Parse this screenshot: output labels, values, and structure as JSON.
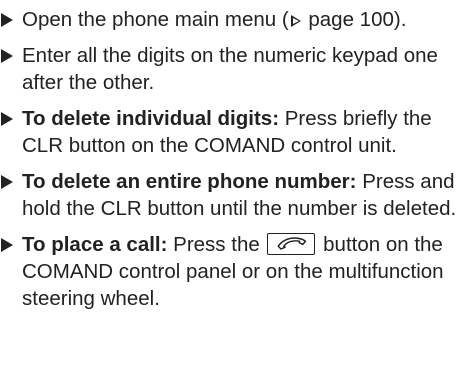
{
  "steps": [
    {
      "text_before": "Open the phone main menu (",
      "ref_icon": "triangle-outline-icon",
      "text_after": " page 100)."
    },
    {
      "text": "Enter all the digits on the numeric keypad one after the other."
    },
    {
      "lead": "To delete individual digits:",
      "text": " Press briefly the CLR button on the COMAND control unit."
    },
    {
      "lead": "To delete an entire phone number:",
      "text": " Press and hold the CLR button until the number is deleted."
    },
    {
      "lead": "To place a call:",
      "text_before": " Press the ",
      "key_icon": "phone-handset-icon",
      "text_after": " button on the COMAND control panel or on the multifunction steering wheel."
    }
  ]
}
